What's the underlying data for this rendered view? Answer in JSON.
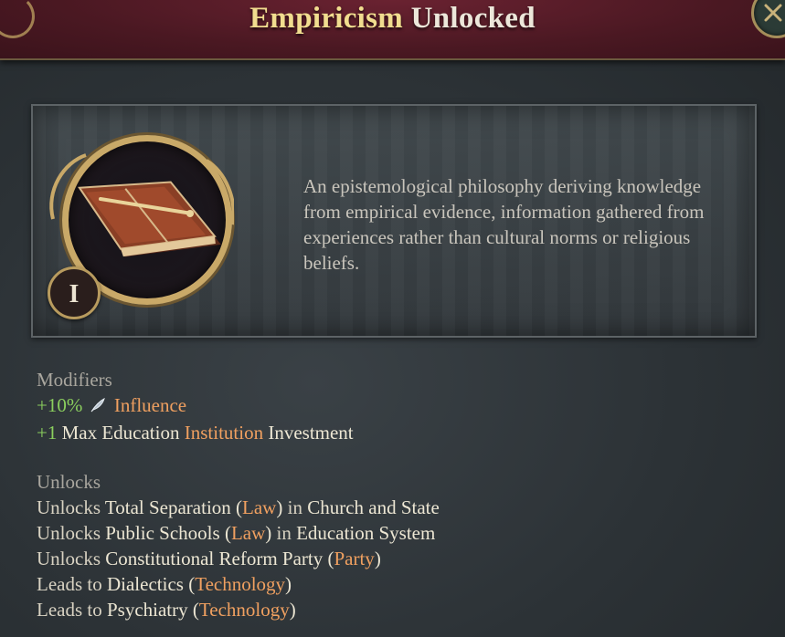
{
  "header": {
    "title_part1": "Empiricism",
    "title_part2": "Unlocked"
  },
  "panel": {
    "tier": "I",
    "icon": "book-and-quill-icon",
    "description": "An epistemological philosophy deriving knowledge from empirical evidence, information gathered from experiences rather than cultural norms or religious beliefs."
  },
  "modifiers": {
    "heading": "Modifiers",
    "items": [
      {
        "value": "+10%",
        "icon": "influence-feather-icon",
        "name": "Influence"
      },
      {
        "value": "+1",
        "pre": "Max Education",
        "link": "Institution",
        "post": "Investment"
      }
    ]
  },
  "unlocks": {
    "heading": "Unlocks",
    "items": [
      {
        "verb": "Unlocks",
        "target": "Total Separation",
        "type": "Law",
        "connector": "in",
        "context": "Church and State"
      },
      {
        "verb": "Unlocks",
        "target": "Public Schools",
        "type": "Law",
        "connector": "in",
        "context": "Education System"
      },
      {
        "verb": "Unlocks",
        "target": "Constitutional Reform Party",
        "type": "Party"
      },
      {
        "verb": "Leads to",
        "target": "Dialectics",
        "type": "Technology"
      },
      {
        "verb": "Leads to",
        "target": "Psychiatry",
        "type": "Technology"
      }
    ]
  },
  "colors": {
    "title_gold": "#f1dd8f",
    "positive_green": "#8bcf5e",
    "link_orange": "#f0a060",
    "header_crimson": "#4a1822"
  }
}
